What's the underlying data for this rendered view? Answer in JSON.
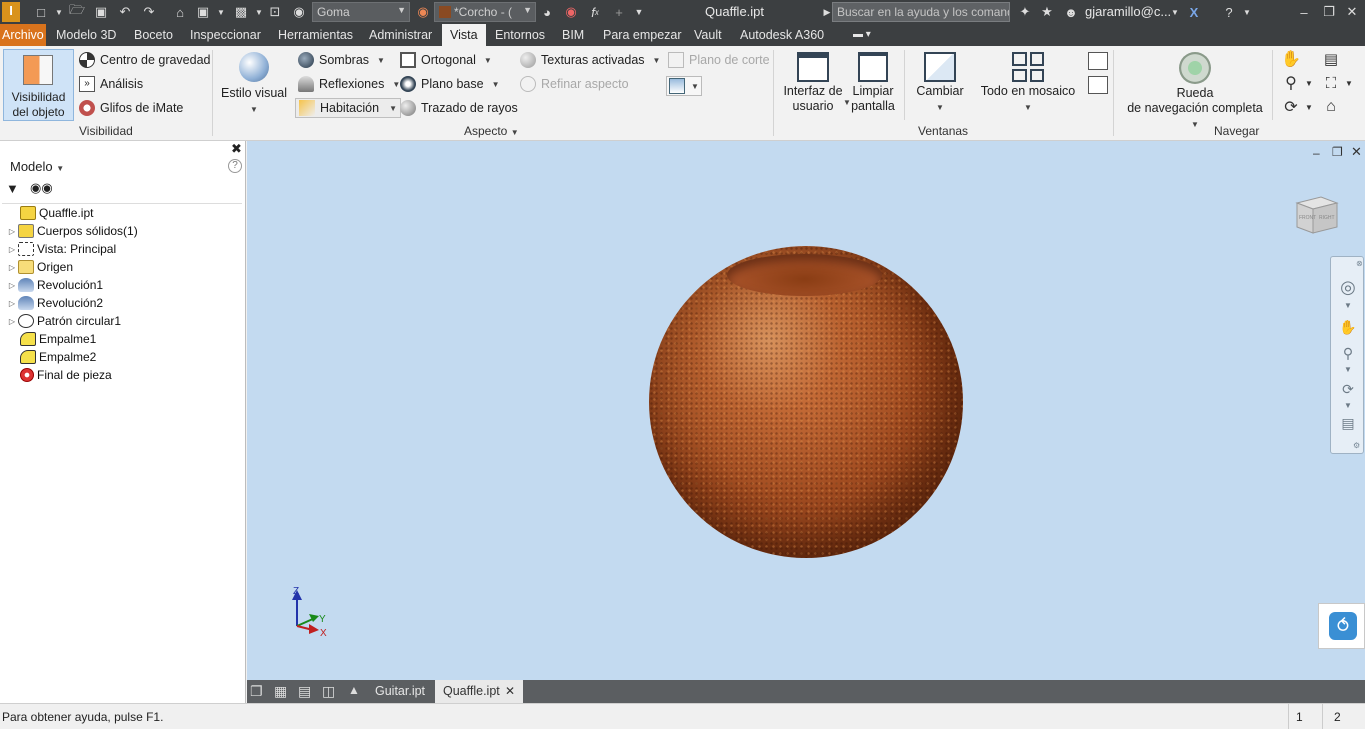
{
  "titlebar": {
    "material": "Goma",
    "appearance": "*Corcho - (",
    "title": "Quaffle.ipt",
    "search_placeholder": "Buscar en la ayuda y los comandos",
    "user": "gjaramillo@c..."
  },
  "menu": {
    "tabs": [
      "Archivo",
      "Modelo 3D",
      "Boceto",
      "Inspeccionar",
      "Herramientas",
      "Administrar",
      "Vista",
      "Entornos",
      "BIM",
      "Para empezar",
      "Vault",
      "Autodesk A360"
    ],
    "active": "Vista"
  },
  "ribbon": {
    "visibility": {
      "big_button": "Visibilidad del objeto",
      "big_line1": "Visibilidad",
      "big_line2": "del objeto",
      "items": [
        "Centro de gravedad",
        "Análisis",
        "Glifos de iMate"
      ],
      "label": "Visibilidad"
    },
    "appearance": {
      "visual_style": "Estilo visual",
      "col1": [
        "Sombras",
        "Reflexiones",
        "Habitación"
      ],
      "col2": [
        "Ortogonal",
        "Plano base",
        "Trazado de rayos"
      ],
      "col3": [
        "Texturas activadas",
        "Refinar aspecto"
      ],
      "section_plane": "Plano de corte",
      "label": "Aspecto"
    },
    "windows": {
      "ui_line1": "Interfaz de",
      "ui_line2": "usuario",
      "clean_line1": "Limpiar",
      "clean_line2": "pantalla",
      "switch": "Cambiar",
      "tile": "Todo en mosaico",
      "label": "Ventanas"
    },
    "navigate": {
      "wheel_line1": "Rueda",
      "wheel_line2": "de navegación completa",
      "label": "Navegar"
    }
  },
  "browser": {
    "title": "Modelo",
    "tree": [
      {
        "label": "Quaffle.ipt",
        "expandable": false,
        "icon": "part-icon"
      },
      {
        "label": "Cuerpos sólidos(1)",
        "expandable": true,
        "icon": "solid-bodies-icon"
      },
      {
        "label": "Vista: Principal",
        "expandable": true,
        "icon": "view-rep-icon"
      },
      {
        "label": "Origen",
        "expandable": true,
        "icon": "folder-icon"
      },
      {
        "label": "Revolución1",
        "expandable": true,
        "icon": "revolve-icon"
      },
      {
        "label": "Revolución2",
        "expandable": true,
        "icon": "revolve-icon"
      },
      {
        "label": "Patrón circular1",
        "expandable": true,
        "icon": "circular-pattern-icon"
      },
      {
        "label": "Empalme1",
        "expandable": false,
        "icon": "fillet-icon"
      },
      {
        "label": "Empalme2",
        "expandable": false,
        "icon": "fillet-icon"
      },
      {
        "label": "Final de pieza",
        "expandable": false,
        "icon": "end-of-part-icon"
      }
    ]
  },
  "viewport": {
    "viewcube_front": "FRONT",
    "viewcube_right": "RIGHT",
    "axes": {
      "z": "Z",
      "y": "Y",
      "x": "X"
    }
  },
  "doctabs": {
    "tabs": [
      "Guitar.ipt",
      "Quaffle.ipt"
    ],
    "active": "Quaffle.ipt"
  },
  "status": {
    "help": "Para obtener ayuda, pulse F1.",
    "count1": "1",
    "count2": "2"
  },
  "colors": {
    "file_tab": "#d9731c",
    "titlebar": "#3c3f41",
    "viewport_bg": "#c3daf0",
    "sphere": "#a04b20"
  }
}
